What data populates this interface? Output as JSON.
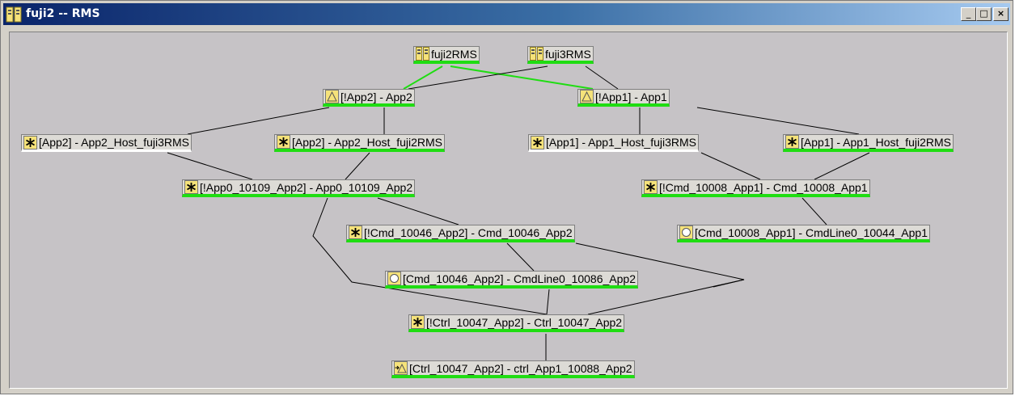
{
  "window": {
    "title": "fuji2 -- RMS",
    "controls": {
      "minimize": "_",
      "maximize": "□",
      "close": "×"
    }
  },
  "colors": {
    "online": "#1fdd12",
    "offline": "#ffffff",
    "edge": "#000000",
    "highlight_edge": "#1fdd12"
  },
  "nodes": [
    {
      "id": "fuji2rms",
      "icon": "host-icon",
      "label": "fuji2RMS",
      "status": "online"
    },
    {
      "id": "fuji3rms",
      "icon": "host-icon",
      "label": "fuji3RMS",
      "status": "online"
    },
    {
      "id": "app2",
      "icon": "userapplication-icon",
      "label": "[!App2]  -  App2",
      "status": "online"
    },
    {
      "id": "app1",
      "icon": "userapplication-icon",
      "label": "[!App1]  -  App1",
      "status": "online"
    },
    {
      "id": "app2_host_fuji3",
      "icon": "gresource-icon",
      "label": "[App2]  -  App2_Host_fuji3RMS",
      "status": "offline"
    },
    {
      "id": "app2_host_fuji2",
      "icon": "gresource-icon",
      "label": "[App2]  -  App2_Host_fuji2RMS",
      "status": "online"
    },
    {
      "id": "app1_host_fuji3",
      "icon": "gresource-icon",
      "label": "[App1]  -  App1_Host_fuji3RMS",
      "status": "offline"
    },
    {
      "id": "app1_host_fuji2",
      "icon": "gresource-icon",
      "label": "[App1]  -  App1_Host_fuji2RMS",
      "status": "online"
    },
    {
      "id": "app0_10109",
      "icon": "gresource-icon",
      "label": "[!App0_10109_App2]  -  App0_10109_App2",
      "status": "online"
    },
    {
      "id": "cmd_10008",
      "icon": "gresource-icon",
      "label": "[!Cmd_10008_App1]  -  Cmd_10008_App1",
      "status": "online"
    },
    {
      "id": "cmd_10046",
      "icon": "gresource-icon",
      "label": "[!Cmd_10046_App2]  -  Cmd_10046_App2",
      "status": "online"
    },
    {
      "id": "cmdline_10044",
      "icon": "cmdline-icon",
      "label": "[Cmd_10008_App1]  -  CmdLine0_10044_App1",
      "status": "online"
    },
    {
      "id": "cmdline_10086",
      "icon": "cmdline-icon",
      "label": "[Cmd_10046_App2]  -  CmdLine0_10086_App2",
      "status": "online"
    },
    {
      "id": "ctrl_10047",
      "icon": "gresource-icon",
      "label": "[!Ctrl_10047_App2]  -  Ctrl_10047_App2",
      "status": "online"
    },
    {
      "id": "ctrl_app1_10088",
      "icon": "controller-icon",
      "label": "[Ctrl_10047_App2]  -  ctrl_App1_10088_App2",
      "status": "online"
    }
  ]
}
